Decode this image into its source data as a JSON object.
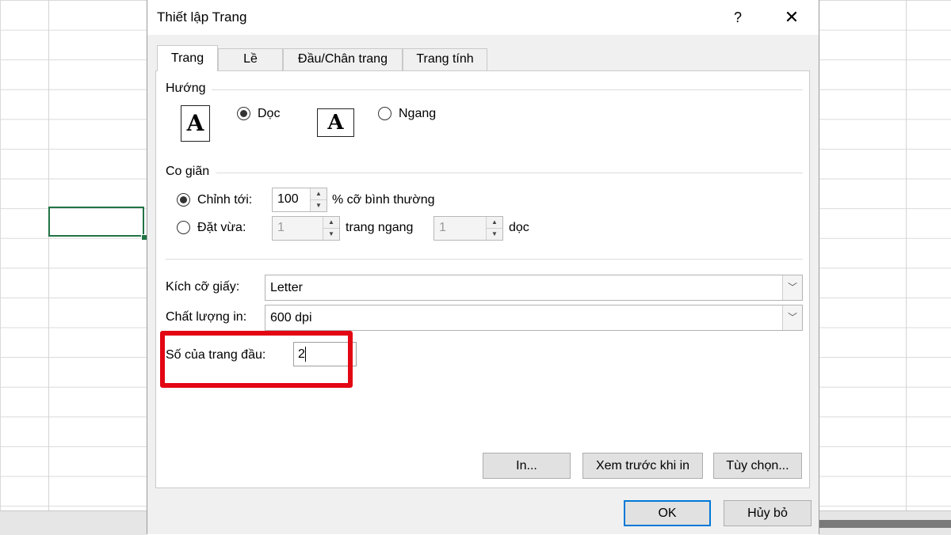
{
  "dialog": {
    "title": "Thiết lập Trang",
    "help_label": "?",
    "close_label": "✕",
    "tabs": [
      {
        "label": "Trang"
      },
      {
        "label": "Lề"
      },
      {
        "label": "Đầu/Chân trang"
      },
      {
        "label": "Trang tính"
      }
    ],
    "orientation": {
      "heading": "Hướng",
      "portrait_label": "Dọc",
      "landscape_label": "Ngang",
      "selected": "portrait",
      "icon_glyph": "A"
    },
    "scaling": {
      "heading": "Co giãn",
      "adjust_label": "Chỉnh tới:",
      "adjust_value": "100",
      "adjust_suffix": "% cỡ bình thường",
      "fit_label": "Đặt vừa:",
      "fit_wide_value": "1",
      "fit_wide_suffix": "trang ngang",
      "fit_tall_value": "1",
      "fit_tall_suffix": "dọc",
      "selected": "adjust"
    },
    "paper_size": {
      "label": "Kích cỡ giấy:",
      "value": "Letter"
    },
    "print_quality": {
      "label": "Chất lượng in:",
      "value": "600 dpi"
    },
    "first_page_number": {
      "label": "Số của trang đầu:",
      "value": "2"
    },
    "buttons": {
      "print": "In...",
      "print_preview": "Xem trước khi in",
      "options": "Tùy chọn...",
      "ok": "OK",
      "cancel": "Hủy bỏ"
    }
  },
  "colors": {
    "highlight": "#e30613",
    "selected_cell_border": "#217346",
    "default_button_border": "#0078d7"
  }
}
